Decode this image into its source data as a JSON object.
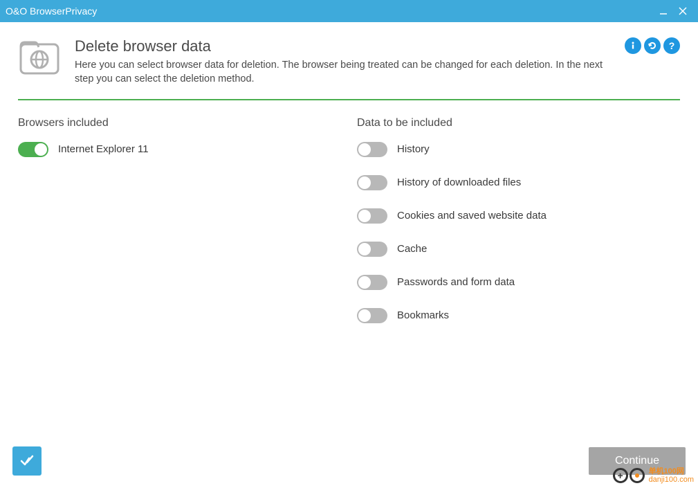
{
  "titlebar": {
    "title": "O&O BrowserPrivacy"
  },
  "header": {
    "title": "Delete browser data",
    "description": "Here you can select browser data for deletion. The browser being treated can be changed for each deletion. In the next step you can select the deletion method."
  },
  "sections": {
    "browsers_title": "Browsers included",
    "data_title": "Data to be included"
  },
  "browsers": [
    {
      "label": "Internet Explorer 11",
      "on": true
    }
  ],
  "data_items": [
    {
      "label": "History",
      "on": false
    },
    {
      "label": "History of downloaded files",
      "on": false
    },
    {
      "label": "Cookies and saved website data",
      "on": false
    },
    {
      "label": "Cache",
      "on": false
    },
    {
      "label": "Passwords and form data",
      "on": false
    },
    {
      "label": "Bookmarks",
      "on": false
    }
  ],
  "footer": {
    "continue": "Continue"
  },
  "watermark": {
    "top": "单机100网",
    "bottom": "danji100.com"
  }
}
